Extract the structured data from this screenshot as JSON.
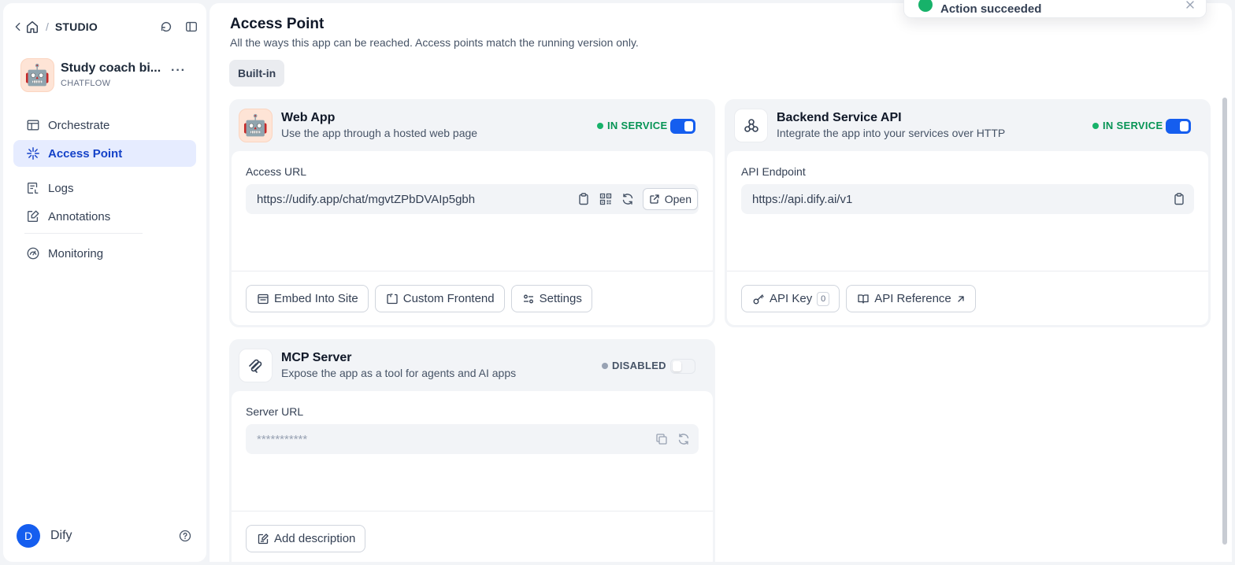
{
  "breadcrumb": {
    "section": "STUDIO"
  },
  "app": {
    "icon": "🤖",
    "name": "Study coach bi...",
    "type": "CHATFLOW",
    "more_label": "···"
  },
  "nav": {
    "items": [
      {
        "label": "Orchestrate",
        "icon": "layout-icon"
      },
      {
        "label": "Access Point",
        "icon": "sparkle-icon",
        "active": true
      },
      {
        "label": "Logs",
        "icon": "logs-icon"
      },
      {
        "label": "Annotations",
        "icon": "annotation-icon"
      },
      {
        "label": "Monitoring",
        "icon": "gauge-icon"
      }
    ]
  },
  "user": {
    "initial": "D",
    "name": "Dify"
  },
  "page": {
    "title": "Access Point",
    "subtitle": "All the ways this app can be reached. Access points match the running version only.",
    "tab": "Built-in"
  },
  "toast": {
    "message": "Action succeeded"
  },
  "web_app": {
    "icon": "🤖",
    "title": "Web App",
    "description": "Use the app through a hosted web page",
    "status": "IN SERVICE",
    "enabled": true,
    "field_label": "Access URL",
    "url": "https://udify.app/chat/mgvtZPbDVAIp5gbh",
    "open_label": "Open",
    "buttons": {
      "embed": "Embed Into Site",
      "custom": "Custom Frontend",
      "settings": "Settings"
    }
  },
  "backend_api": {
    "title": "Backend Service API",
    "description": "Integrate the app into your services over HTTP",
    "status": "IN SERVICE",
    "enabled": true,
    "field_label": "API Endpoint",
    "url": "https://api.dify.ai/v1",
    "buttons": {
      "api_key": "API Key",
      "api_key_count": "0",
      "api_reference": "API Reference"
    }
  },
  "mcp": {
    "title": "MCP Server",
    "description": "Expose the app as a tool for agents and AI apps",
    "status": "DISABLED",
    "enabled": false,
    "field_label": "Server URL",
    "url": "***********",
    "buttons": {
      "add_description": "Add description"
    }
  },
  "colors": {
    "accent": "#155eef",
    "active_bg": "#e6ecff",
    "success": "#17b26a",
    "page_bg": "#f2f4f7"
  }
}
